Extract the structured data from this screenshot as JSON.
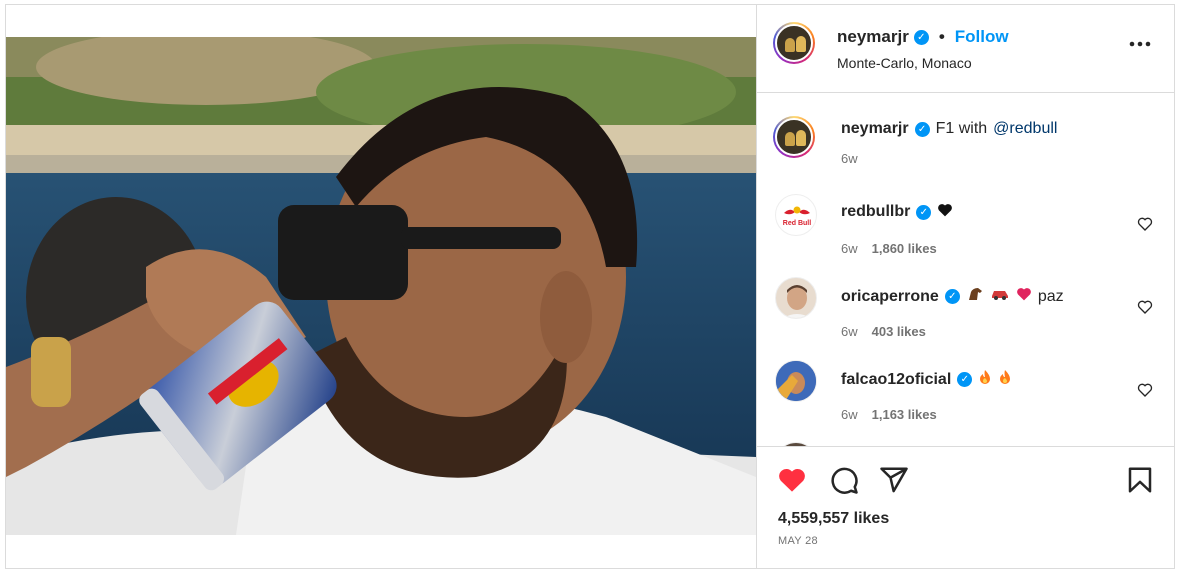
{
  "post": {
    "author": "neymarjr",
    "follow_label": "Follow",
    "location": "Monte-Carlo, Monaco",
    "separator": "•",
    "more_label": "•••"
  },
  "caption": {
    "author": "neymarjr",
    "text": "F1 with",
    "mention": "@redbull",
    "age": "6w"
  },
  "comments": [
    {
      "author": "redbullbr",
      "text": "",
      "emojis": [
        "black-heart"
      ],
      "age": "6w",
      "likes": "1,860 likes"
    },
    {
      "author": "oricaperrone",
      "text": "paz",
      "emojis": [
        "horse",
        "car",
        "red-heart"
      ],
      "age": "6w",
      "likes": "403 likes"
    },
    {
      "author": "falcao12oficial",
      "text": "",
      "emojis": [
        "fire",
        "fire"
      ],
      "age": "6w",
      "likes": "1,163 likes"
    }
  ],
  "engagement": {
    "likes": "4,559,557 likes",
    "date": "MAY 28",
    "liked": true
  },
  "avatar_labels": {
    "redbullbr": "Red Bull"
  },
  "colors": {
    "accent": "#0095f6",
    "like_red": "#ff3040",
    "mention": "#00376b",
    "secondary_text": "#737373",
    "border": "#dbdbdb"
  },
  "icons": {
    "verified": "verified-badge-icon",
    "like": "heart-filled-icon",
    "comment": "comment-bubble-icon",
    "share": "paper-plane-icon",
    "save": "bookmark-icon",
    "more": "ellipsis-icon"
  }
}
